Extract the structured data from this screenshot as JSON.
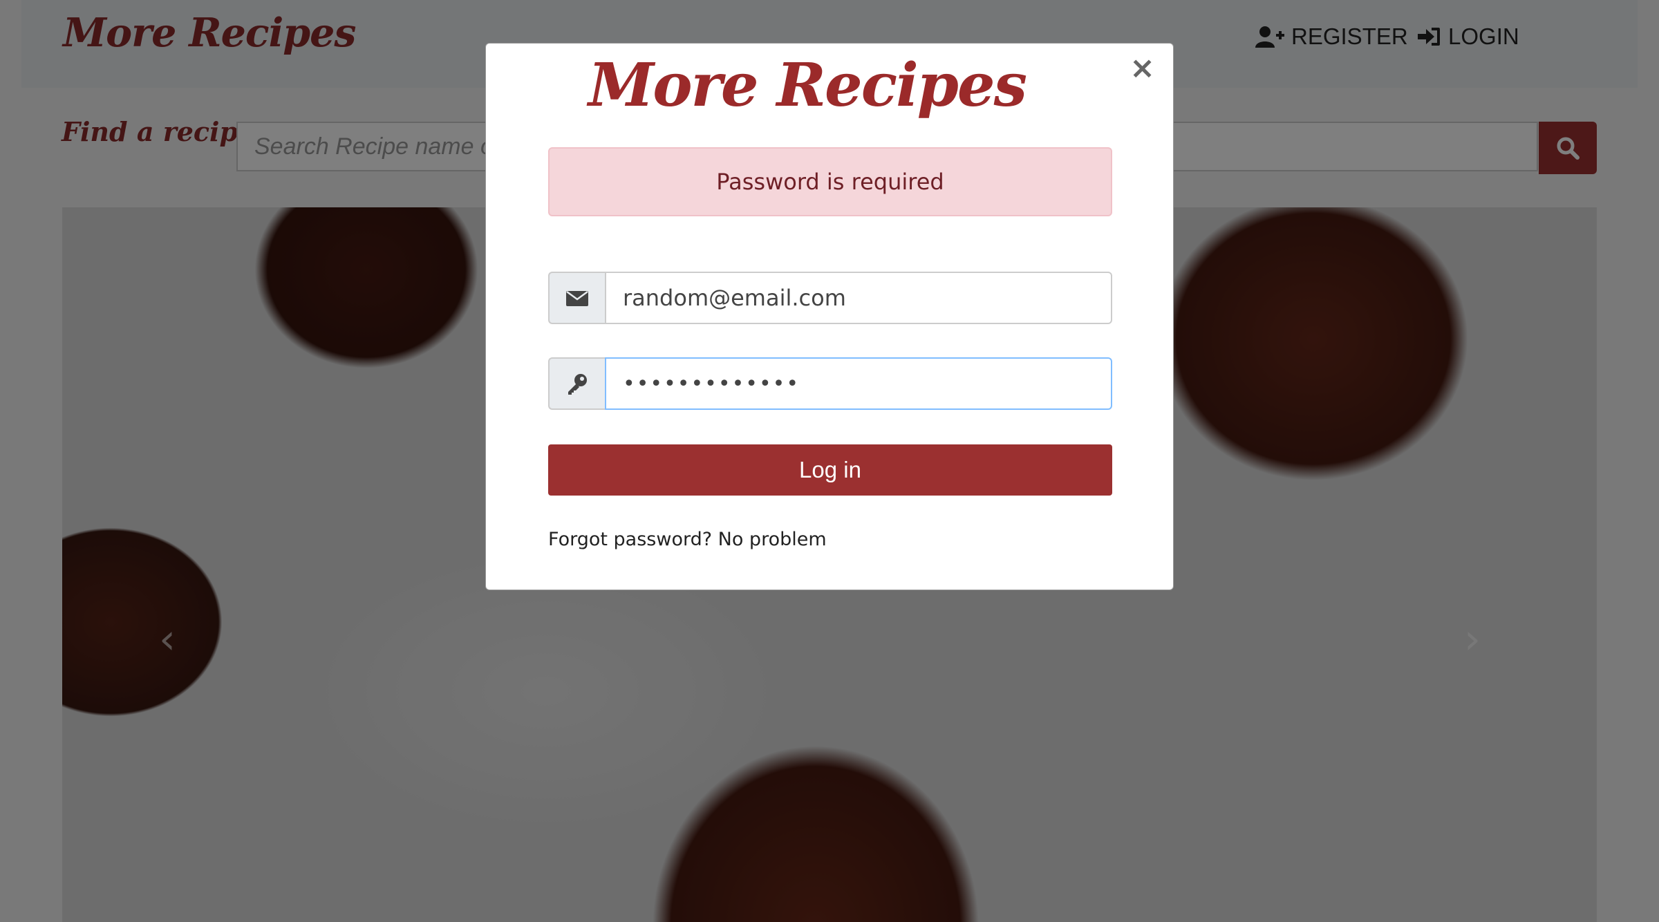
{
  "navbar": {
    "brand": "More Recipes",
    "register_label": "REGISTER",
    "login_label": "LOGIN"
  },
  "search": {
    "label": "Find a recipe:",
    "placeholder": "Search Recipe name or"
  },
  "carousel": {
    "prev_symbol": "‹",
    "next_symbol": "›"
  },
  "modal": {
    "brand": "More Recipes",
    "close_symbol": "×",
    "alert_text": "Password is required",
    "email_value": "random@email.com",
    "password_value": "•••••••••••••",
    "login_button": "Log in",
    "forgot_text": "Forgot password? No problem"
  },
  "colors": {
    "brand": "#9b2a2a",
    "accent": "#9b3030",
    "alert_bg": "#f5d6da",
    "alert_text": "#6e1f26"
  },
  "icons": {
    "register": "user-plus-icon",
    "login": "sign-in-icon",
    "search": "search-icon",
    "email": "envelope-icon",
    "password": "key-icon",
    "close": "close-icon"
  }
}
